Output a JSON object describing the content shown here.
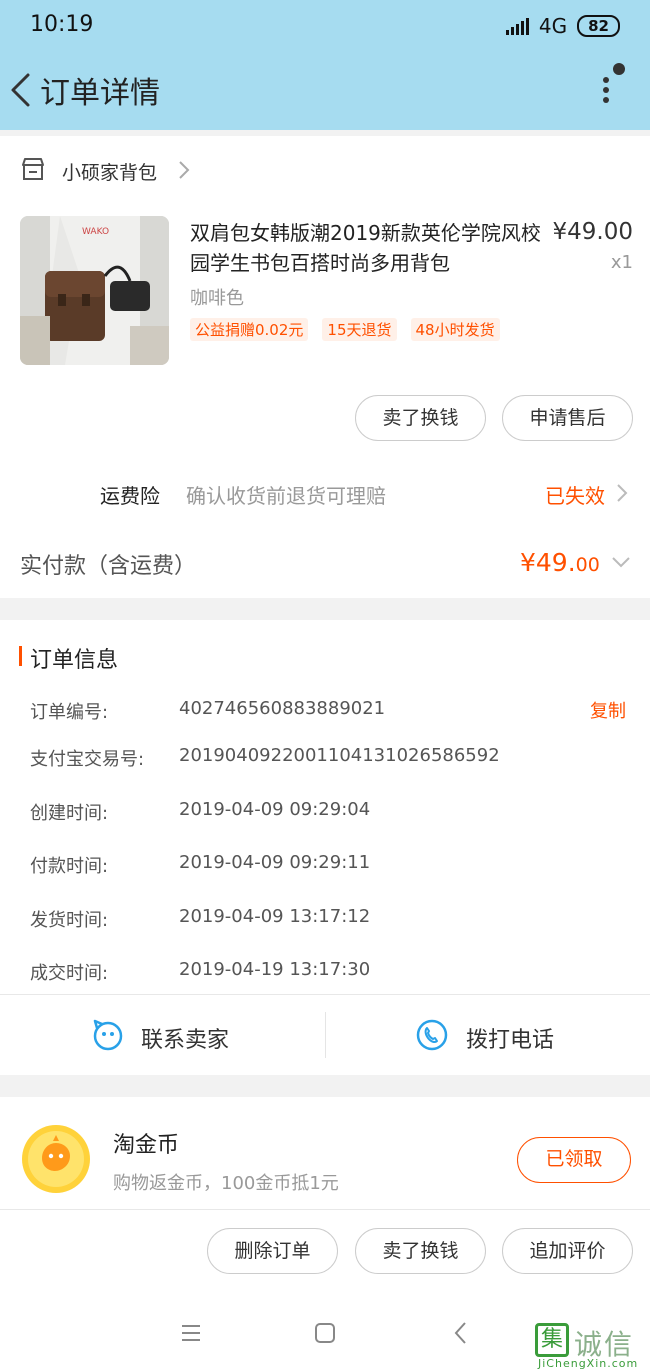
{
  "status_bar": {
    "time": "10:19",
    "network": "4G",
    "battery": "82"
  },
  "header": {
    "title": "订单详情"
  },
  "shop": {
    "name": "小硕家背包"
  },
  "product": {
    "title": "双肩包女韩版潮2019新款英伦学院风校园学生书包百搭时尚多用背包",
    "price": "¥49.00",
    "quantity": "x1",
    "variant": "咖啡色",
    "tags": [
      "公益捐赠0.02元",
      "15天退货",
      "48小时发货"
    ]
  },
  "actions": {
    "sell": "卖了换钱",
    "after_sale": "申请售后"
  },
  "insurance": {
    "label": "运费险",
    "description": "确认收货前退货可理赔",
    "status": "已失效"
  },
  "payment": {
    "label": "实付款（含运费）",
    "amount_main": "¥49.",
    "amount_cents": "00"
  },
  "order_info": {
    "title": "订单信息",
    "copy_label": "复制",
    "rows": [
      {
        "label": "订单编号:",
        "value": "402746560883889021"
      },
      {
        "label": "支付宝交易号:",
        "value": "2019040922001104131026586592"
      },
      {
        "label": "创建时间:",
        "value": "2019-04-09 09:29:04"
      },
      {
        "label": "付款时间:",
        "value": "2019-04-09 09:29:11"
      },
      {
        "label": "发货时间:",
        "value": "2019-04-09 13:17:12"
      },
      {
        "label": "成交时间:",
        "value": "2019-04-19 13:17:30"
      }
    ]
  },
  "contact": {
    "seller": "联系卖家",
    "call": "拨打电话"
  },
  "coin": {
    "title": "淘金币",
    "subtitle": "购物返金币，100金币抵1元",
    "button": "已领取"
  },
  "bottom_actions": {
    "delete": "删除订单",
    "sell": "卖了换钱",
    "review": "追加评价"
  },
  "watermark": {
    "char": "集",
    "text": "诚信",
    "domain": "JiChengXin.com"
  },
  "colors": {
    "header_bg": "#a6dcf0",
    "accent": "#ff5000",
    "contact_icon": "#29a1e8"
  }
}
